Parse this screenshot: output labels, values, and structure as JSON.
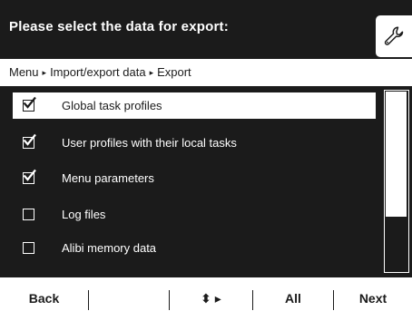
{
  "header": {
    "title": "Please select the data for export:",
    "settings_icon": "wrench-icon"
  },
  "breadcrumb": {
    "items": [
      "Menu",
      "Import/export data",
      "Export"
    ],
    "separator": "▸"
  },
  "list": {
    "items": [
      {
        "label": "Global task profiles",
        "checked": true,
        "selected": true
      },
      {
        "label": "User profiles with their local tasks",
        "checked": true,
        "selected": false
      },
      {
        "label": "Menu parameters",
        "checked": true,
        "selected": false
      },
      {
        "label": "Log files",
        "checked": false,
        "selected": false
      },
      {
        "label": "Alibi memory data",
        "checked": false,
        "selected": false
      }
    ],
    "scroll_position_fraction": 0.0,
    "visible_fraction": 0.7
  },
  "softkeys": {
    "back": "Back",
    "blank1": "",
    "blank2": "",
    "navigate": "⬍ ▸",
    "all": "All",
    "next": "Next"
  },
  "colors": {
    "background_dark": "#1b1b1b",
    "foreground_light": "#ffffff"
  }
}
